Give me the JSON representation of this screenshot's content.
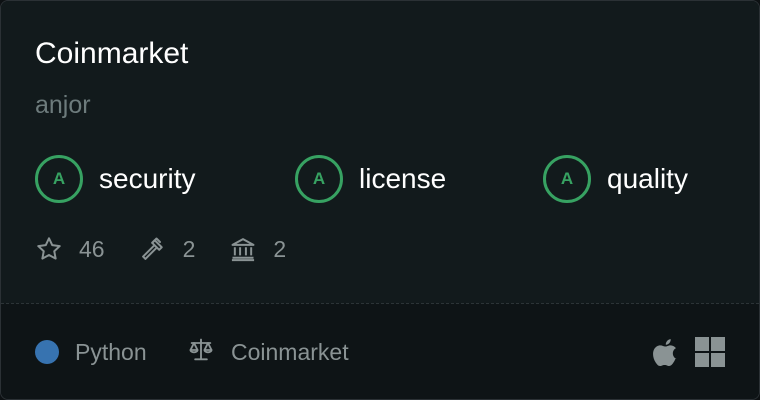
{
  "repo": {
    "name": "Coinmarket",
    "owner": "anjor"
  },
  "grades": [
    {
      "letter": "A",
      "label": "security"
    },
    {
      "letter": "A",
      "label": "license"
    },
    {
      "letter": "A",
      "label": "quality"
    }
  ],
  "stats": {
    "stars": "46",
    "forks": "2",
    "contributors": "2"
  },
  "footer": {
    "language": "Python",
    "language_color": "#3773b0",
    "license": "Coinmarket",
    "platform_icons": [
      "apple-icon",
      "windows-icon"
    ]
  },
  "colors": {
    "grade_accent": "#37a262"
  }
}
